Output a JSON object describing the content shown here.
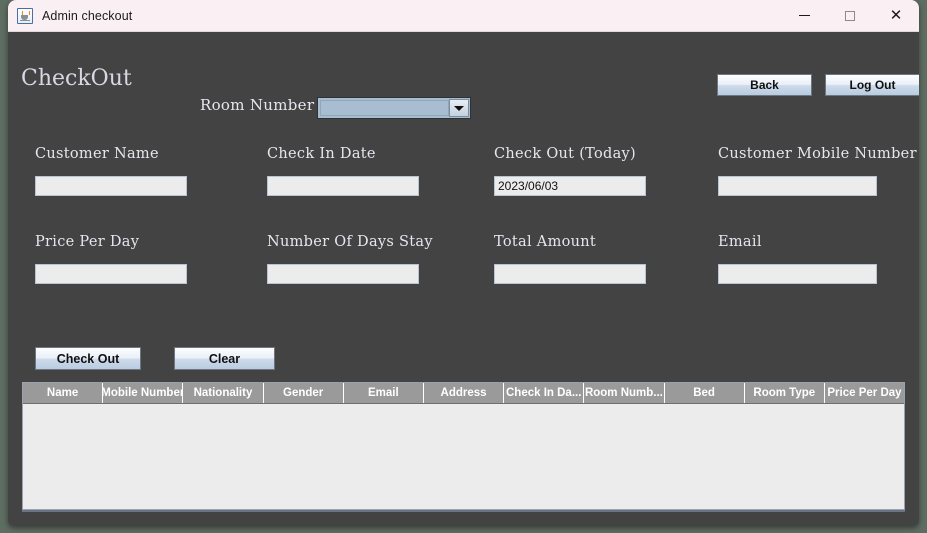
{
  "window": {
    "title": "Admin checkout",
    "icon": "java-coffee-cup-icon",
    "controls": {
      "minimize": "minimize-icon",
      "maximize": "maximize-icon",
      "close": "close-icon"
    }
  },
  "colors": {
    "desktop_backdrop": "#5e6d62",
    "panel_background": "#434343",
    "titlebar_background": "#faf0f4",
    "button_face": "#cddbea",
    "combo_face": "#a9bdd0",
    "input_face": "#ececec",
    "table_header": "#9a9a9a",
    "table_body": "#ececec",
    "label_text": "#e6e6ee"
  },
  "header": {
    "page_title": "CheckOut",
    "room_number_label": "Room Number",
    "room_number_value": "",
    "back_label": "Back",
    "logout_label": "Log Out"
  },
  "form": {
    "fields": [
      {
        "label": "Customer Name",
        "value": ""
      },
      {
        "label": "Check In Date",
        "value": ""
      },
      {
        "label": "Check Out (Today)",
        "value": "2023/06/03"
      },
      {
        "label": "Customer Mobile Number",
        "value": ""
      },
      {
        "label": "Price Per Day",
        "value": ""
      },
      {
        "label": "Number Of Days Stay",
        "value": ""
      },
      {
        "label": "Total Amount",
        "value": ""
      },
      {
        "label": "Email",
        "value": ""
      }
    ]
  },
  "actions": {
    "checkout_label": "Check Out",
    "clear_label": "Clear"
  },
  "table": {
    "columns": [
      "Name",
      "Mobile Number",
      "Nationality",
      "Gender",
      "Email",
      "Address",
      "Check In Da...",
      "Room Numb...",
      "Bed",
      "Room Type",
      "Price Per Day"
    ],
    "rows": []
  }
}
